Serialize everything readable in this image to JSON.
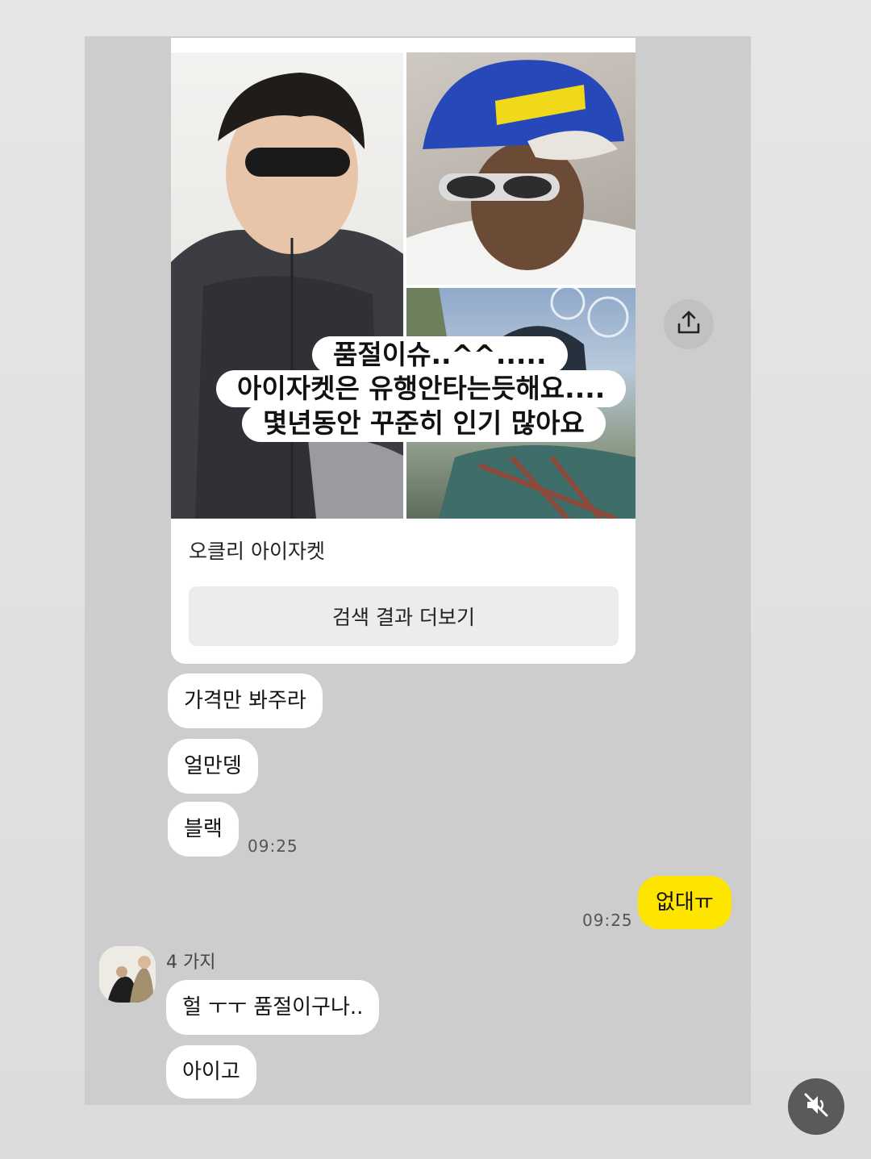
{
  "card": {
    "caption_line1": "품절이슈..^^.....",
    "caption_line2": "아이자켓은 유행안타는듯해요....",
    "caption_line3": "몇년동안 꾸준히 인기 많아요",
    "title": "오클리 아이자켓",
    "more_button_label": "검색 결과 더보기"
  },
  "icons": {
    "share": "share-icon",
    "mute": "volume-mute-icon"
  },
  "colors": {
    "chat_background": "#cdcdcd",
    "my_bubble": "#fee500",
    "their_bubble": "#ffffff"
  },
  "messages": {
    "m1": "가격만 봐주라",
    "m2": "얼만뎅",
    "m3": "블랙",
    "m3_time": "09:25",
    "mine": "없대ㅠ",
    "mine_time": "09:25",
    "sender": "4 가지",
    "m5": "헐 ㅜㅜ 품절이구나..",
    "m6": "아이고"
  }
}
